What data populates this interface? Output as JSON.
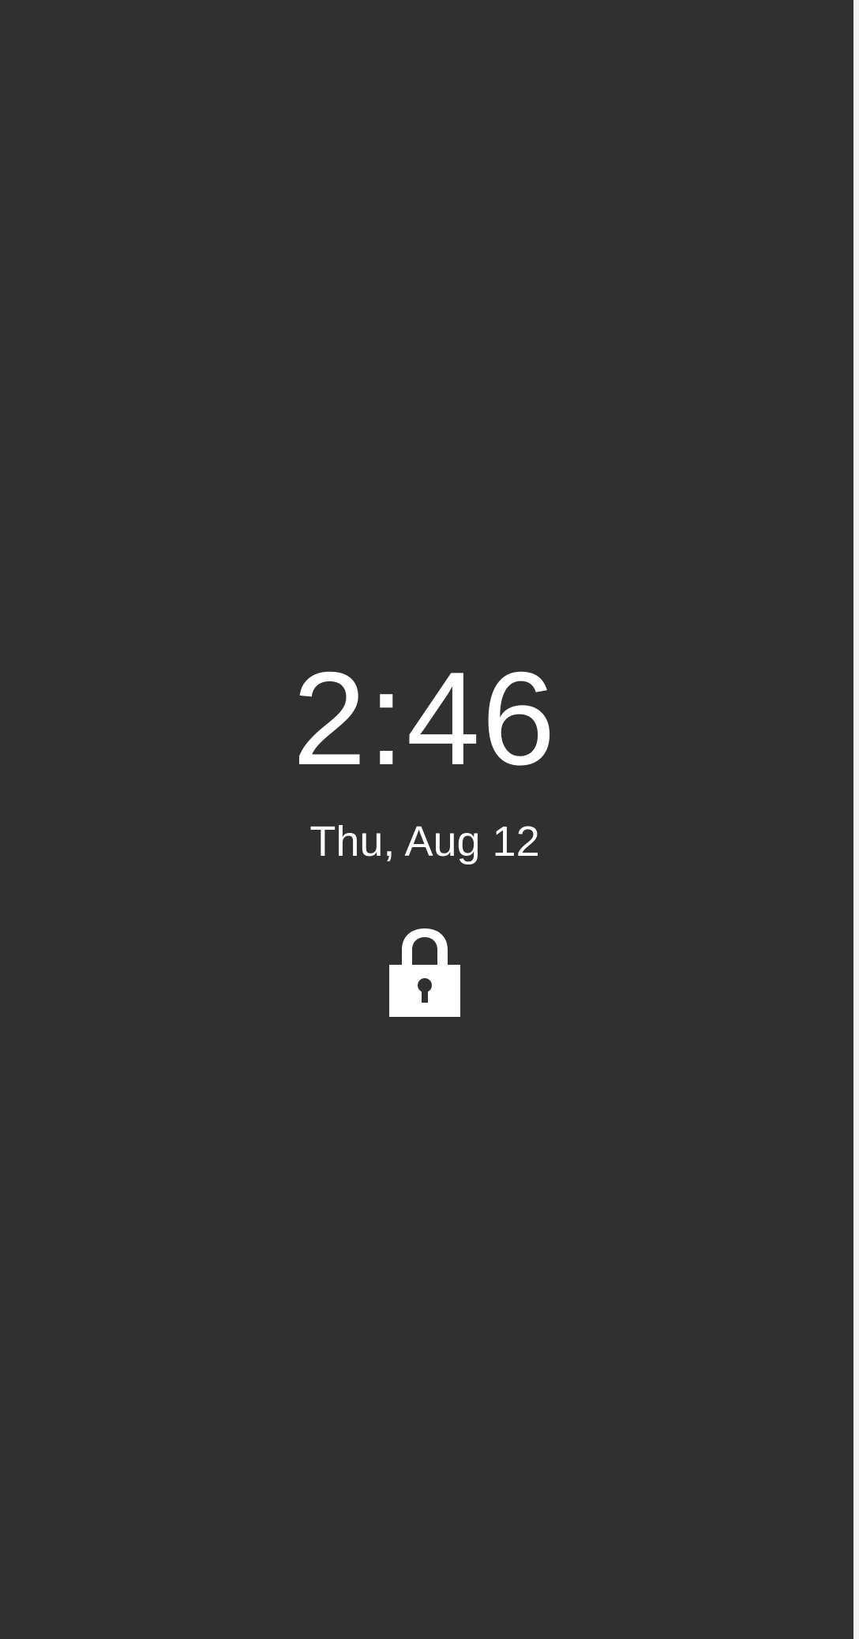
{
  "lockscreen": {
    "time": "2:46",
    "date": "Thu, Aug 12",
    "icon": "lock-icon"
  },
  "colors": {
    "background": "#303030",
    "foreground": "#ffffff",
    "edge": "#f4f4f4"
  }
}
